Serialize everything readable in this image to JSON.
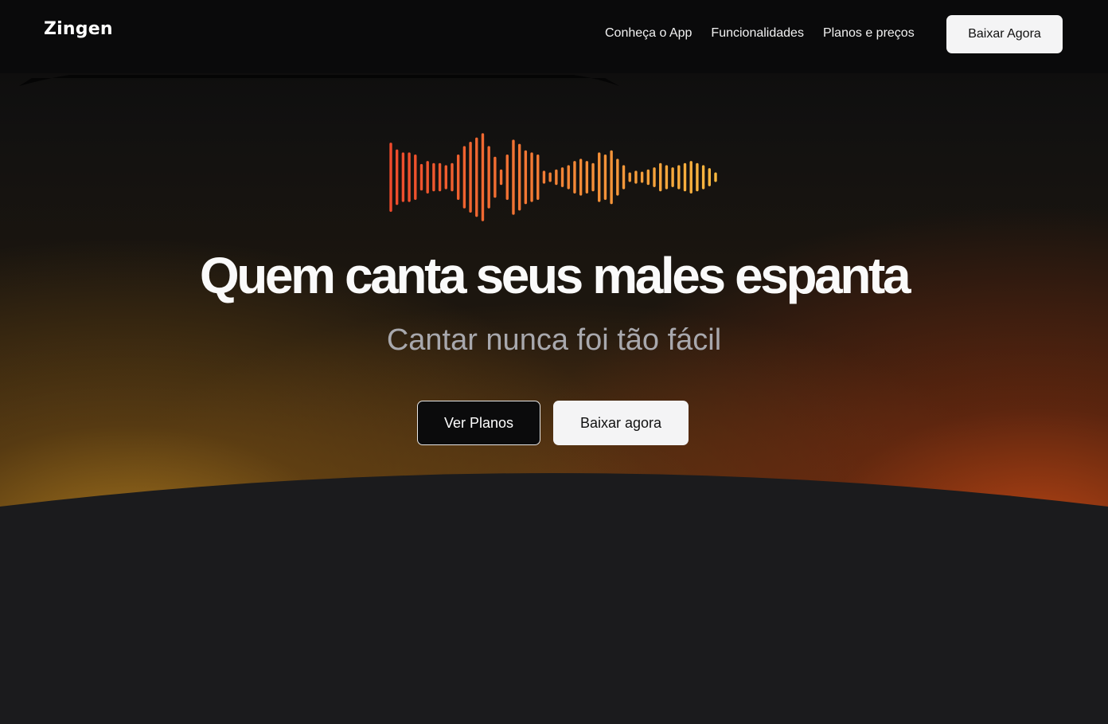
{
  "header": {
    "logo": "Zingen",
    "nav": [
      {
        "label": "Conheça o App"
      },
      {
        "label": "Funcionalidades"
      },
      {
        "label": "Planos e preços"
      }
    ],
    "cta_label": "Baixar Agora"
  },
  "hero": {
    "headline": "Quem canta seus males espanta",
    "subheadline": "Cantar nunca foi tão fácil",
    "primary_button": "Ver Planos",
    "secondary_button": "Baixar agora"
  },
  "waveform": {
    "icon": "audio-waveform",
    "gradient_start": "#ee4a2c",
    "gradient_end": "#f7b73f",
    "bar_levels": [
      0.78,
      0.62,
      0.55,
      0.55,
      0.5,
      0.28,
      0.35,
      0.3,
      0.3,
      0.25,
      0.3,
      0.5,
      0.7,
      0.8,
      0.9,
      1.0,
      0.7,
      0.45,
      0.15,
      0.5,
      0.85,
      0.75,
      0.6,
      0.55,
      0.5,
      0.12,
      0.08,
      0.15,
      0.2,
      0.25,
      0.35,
      0.4,
      0.35,
      0.3,
      0.55,
      0.5,
      0.6,
      0.4,
      0.25,
      0.08,
      0.12,
      0.1,
      0.15,
      0.2,
      0.3,
      0.25,
      0.2,
      0.25,
      0.3,
      0.35,
      0.3,
      0.25,
      0.18,
      0.08
    ]
  },
  "colors": {
    "header_bg": "#0a0a0b",
    "page_bg": "#1b1b1d",
    "glow_left": "#a8781e",
    "glow_right": "#be4614",
    "button_light": "#f4f4f5"
  }
}
